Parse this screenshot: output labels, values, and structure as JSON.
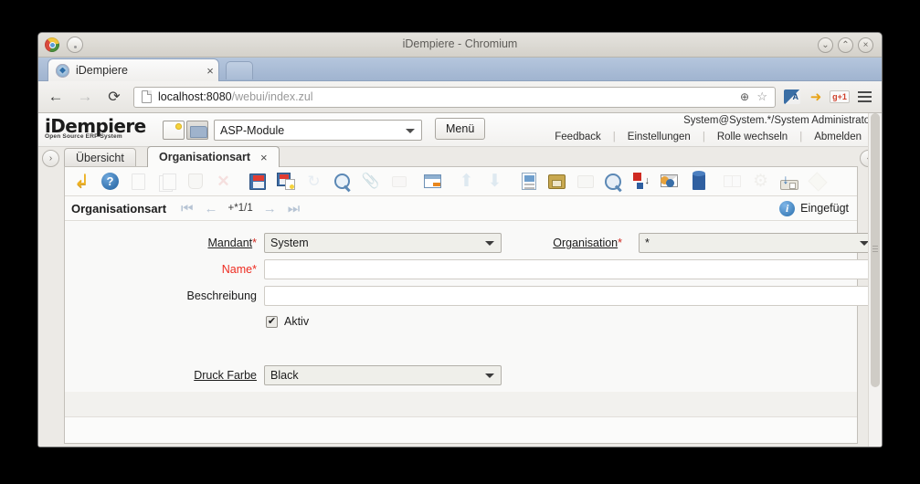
{
  "browser": {
    "window_title": "iDempiere - Chromium",
    "tab_title": "iDempiere",
    "tab_close": "×",
    "url_host": "localhost:8080",
    "url_path": "/webui/index.zul",
    "back_arrow": "←",
    "forward_arrow": "→",
    "reload_glyph": "⟳",
    "zoom_glyph": "⊕",
    "star_glyph": "☆",
    "minimize_glyph": "⌄",
    "maximize_glyph": "⌃",
    "close_glyph": "×",
    "ext_translate_label": "A",
    "ext_mobile_glyph": "➜",
    "ext_gplus_label": "g+1"
  },
  "app": {
    "logo_main": "iDempiere",
    "logo_sub": "Open Source  ERP System",
    "asp_select_value": "ASP-Module",
    "menu_button": "Menü",
    "user_info": "System@System.*/System Administrator",
    "user_links": [
      "Feedback",
      "Einstellungen",
      "Rolle wechseln",
      "Abmelden"
    ],
    "left_collapse_glyph": "›",
    "right_collapse_glyph": "‹"
  },
  "window_tabs": [
    {
      "label": "Übersicht",
      "active": false
    },
    {
      "label": "Organisationsart",
      "active": true,
      "close": "×"
    }
  ],
  "toolbar": {
    "items": [
      {
        "name": "undo-button",
        "icon": "undo-icon",
        "enabled": true
      },
      {
        "name": "help-button",
        "icon": "help-icon",
        "enabled": true
      },
      {
        "name": "new-record-button",
        "icon": "new-document-icon",
        "enabled": false
      },
      {
        "name": "copy-record-button",
        "icon": "copy-documents-icon",
        "enabled": false
      },
      {
        "name": "delete-record-button",
        "icon": "trash-icon",
        "enabled": false
      },
      {
        "name": "delete-selection-button",
        "icon": "red-x-icon",
        "enabled": false
      },
      {
        "name": "save-button",
        "icon": "save-icon",
        "enabled": true
      },
      {
        "name": "save-create-new-button",
        "icon": "save-new-icon",
        "enabled": true
      },
      {
        "name": "refresh-button",
        "icon": "refresh-icon",
        "enabled": false
      },
      {
        "name": "find-button",
        "icon": "magnifier-icon",
        "enabled": true
      },
      {
        "name": "attachment-button",
        "icon": "paperclip-icon",
        "enabled": false
      },
      {
        "name": "chat-button",
        "icon": "chat-bubble-icon",
        "enabled": false
      },
      {
        "name": "grid-toggle-button",
        "icon": "grid-table-icon",
        "enabled": true
      },
      {
        "name": "parent-record-button",
        "icon": "arrow-up-icon",
        "enabled": false
      },
      {
        "name": "detail-record-button",
        "icon": "arrow-down-icon",
        "enabled": false
      },
      {
        "name": "report-button",
        "icon": "report-icon",
        "enabled": true
      },
      {
        "name": "archive-button",
        "icon": "archive-drawer-icon",
        "enabled": true
      },
      {
        "name": "print-button",
        "icon": "printer-icon",
        "enabled": false
      },
      {
        "name": "zoom-across-button",
        "icon": "zoom-back-icon",
        "enabled": true
      },
      {
        "name": "export-button",
        "icon": "export-icon",
        "enabled": true
      },
      {
        "name": "request-button",
        "icon": "contact-envelope-icon",
        "enabled": true
      },
      {
        "name": "product-info-button",
        "icon": "cube-icon",
        "enabled": true
      },
      {
        "name": "view-layout-button",
        "icon": "panels-icon",
        "enabled": false
      },
      {
        "name": "preference-button",
        "icon": "gear-icon",
        "enabled": false
      },
      {
        "name": "process-button",
        "icon": "drive-import-icon",
        "enabled": true
      },
      {
        "name": "post-it-button",
        "icon": "flag-icon",
        "enabled": false
      }
    ]
  },
  "record": {
    "title": "Organisationsart",
    "first_glyph": "⏮",
    "prev_glyph": "←",
    "position": "+*1/1",
    "next_glyph": "→",
    "last_glyph": "⏭",
    "status_text": "Eingefügt",
    "status_icon_glyph": "i"
  },
  "form": {
    "fields": [
      {
        "name": "mandant",
        "label": "Mandant",
        "required_mark": "*",
        "type": "select",
        "value": "System",
        "state": "normal"
      },
      {
        "name": "organisation",
        "label": "Organisation",
        "required_mark": "*",
        "type": "select",
        "value": "*",
        "state": "normal"
      },
      {
        "name": "name",
        "label": "Name",
        "required_mark": "*",
        "type": "text",
        "value": "",
        "state": "required-empty"
      },
      {
        "name": "beschreibung",
        "label": "Beschreibung",
        "required_mark": "",
        "type": "text",
        "value": "",
        "state": "normal"
      },
      {
        "name": "aktiv",
        "label": "Aktiv",
        "type": "checkbox",
        "checked": true,
        "check_glyph": "✔"
      },
      {
        "name": "druck-farbe",
        "label": "Druck Farbe",
        "required_mark": "",
        "type": "select",
        "value": "Black",
        "state": "normal"
      }
    ]
  }
}
